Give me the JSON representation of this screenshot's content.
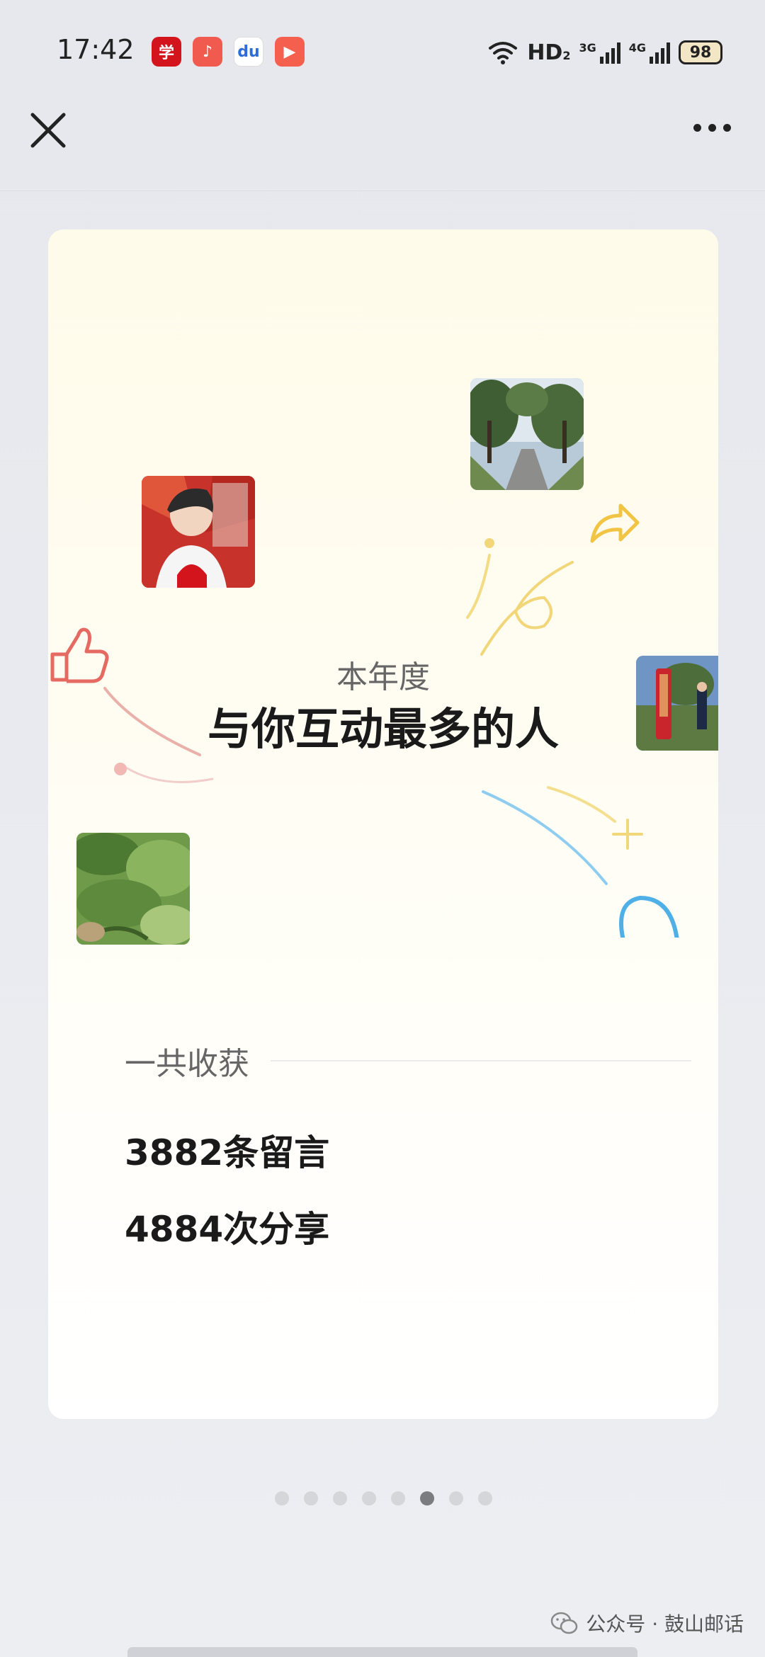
{
  "status_bar": {
    "time": "17:42",
    "network_label": "HD",
    "network_sub": "2",
    "signal_1": "3G",
    "signal_2": "4G",
    "battery": "98"
  },
  "apps": [
    {
      "name": "xuexi-app-icon",
      "glyph": "学"
    },
    {
      "name": "music-app-icon",
      "glyph": "♪"
    },
    {
      "name": "baidu-app-icon",
      "glyph": "du"
    },
    {
      "name": "kuaishou-app-icon",
      "glyph": "▶"
    }
  ],
  "card": {
    "subtitle": "本年度",
    "title": "与你互动最多的人",
    "section_label": "一共收获",
    "stat_comments": "3882条留言",
    "stat_shares": "4884次分享"
  },
  "pager": {
    "count": 8,
    "active_index": 5
  },
  "watermark": {
    "text": "公众号 · 鼓山邮话"
  },
  "colors": {
    "accent_like": "#e56a62",
    "accent_share": "#f2c443",
    "accent_blue": "#5fb8ea"
  }
}
